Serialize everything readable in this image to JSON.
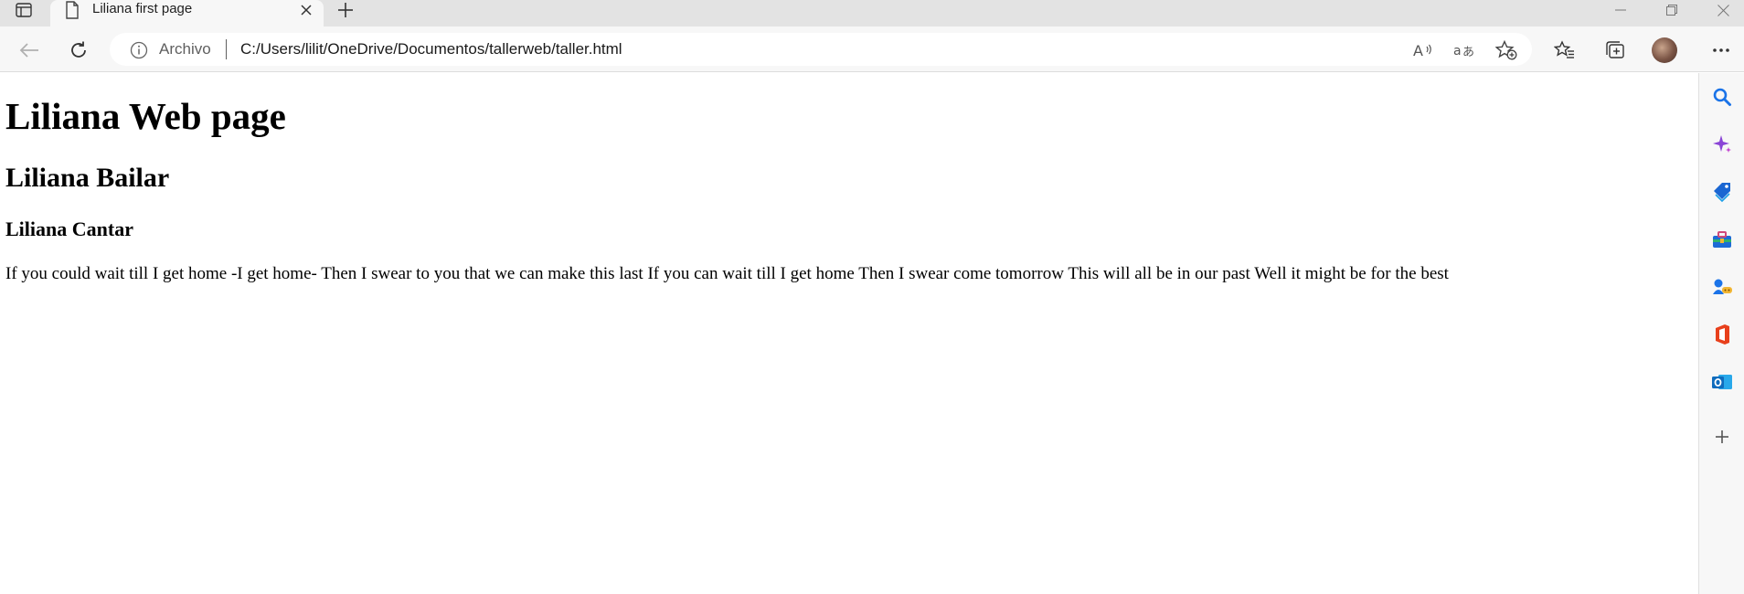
{
  "tab": {
    "title": "Liliana first page"
  },
  "address_bar": {
    "site_info_label": "Archivo",
    "url": "C:/Users/lilit/OneDrive/Documentos/tallerweb/taller.html"
  },
  "page": {
    "heading1": "Liliana Web page",
    "heading2": "Liliana Bailar",
    "heading3": "Liliana Cantar",
    "paragraph": "If you could wait till I get home -I get home- Then I swear to you that we can make this last If you can wait till I get home Then I swear come tomorrow This will all be in our past Well it might be for the best"
  },
  "sidebar": {
    "items": [
      "search-icon",
      "copilot-icon",
      "shopping-icon",
      "tools-icon",
      "games-icon",
      "office-icon",
      "outlook-icon",
      "add-icon"
    ]
  },
  "colors": {
    "tabstrip": "#e3e3e3",
    "toolbar": "#f7f7f7",
    "accent_blue": "#1a73e8",
    "copilot_purple": "#8a45d6",
    "office_red": "#e8401c",
    "outlook_blue": "#0f6cbd"
  }
}
